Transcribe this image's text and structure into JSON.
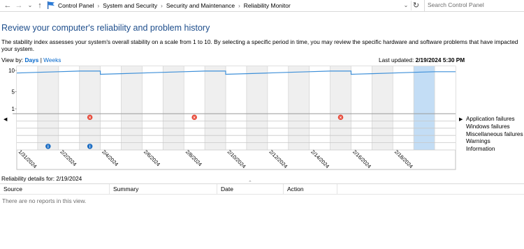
{
  "nav": {
    "breadcrumbs": [
      "Control Panel",
      "System and Security",
      "Security and Maintenance",
      "Reliability Monitor"
    ],
    "search_placeholder": "Search Control Panel"
  },
  "header": {
    "title": "Review your computer's reliability and problem history",
    "description": "The stability index assesses your system's overall stability on a scale from 1 to 10. By selecting a specific period in time, you may review the specific hardware and software problems that have impacted your system."
  },
  "view": {
    "label": "View by:",
    "days": "Days",
    "separator": "|",
    "weeks": "Weeks",
    "selected": "Days",
    "last_updated_label": "Last updated:",
    "last_updated_value": "2/19/2024 5:30 PM"
  },
  "chart_data": {
    "type": "line",
    "y_ticks": [
      "10",
      "5",
      "1"
    ],
    "ylim": [
      1,
      10
    ],
    "columns": [
      "1/31",
      "2/1",
      "2/2",
      "2/3",
      "2/4",
      "2/5",
      "2/6",
      "2/7",
      "2/8",
      "2/9",
      "2/10",
      "2/11",
      "2/12",
      "2/13",
      "2/14",
      "2/15",
      "2/16",
      "2/17",
      "2/18",
      "2/19",
      "2/20"
    ],
    "date_labels": [
      "1/31/2024",
      "2/2/2024",
      "2/4/2024",
      "2/6/2024",
      "2/8/2024",
      "2/10/2024",
      "2/12/2024",
      "2/14/2024",
      "2/16/2024",
      "2/18/2024"
    ],
    "stability_index": [
      9.4,
      9.55,
      9.7,
      9.85,
      9.1,
      9.25,
      9.4,
      9.55,
      9.7,
      9.85,
      9.1,
      9.25,
      9.4,
      9.55,
      9.7,
      9.85,
      9.1,
      9.25,
      9.4,
      9.55,
      9.7
    ],
    "event_rows": [
      "Application failures",
      "Windows failures",
      "Miscellaneous failures",
      "Warnings",
      "Information"
    ],
    "events": [
      {
        "row": "Application failures",
        "column": "2/3",
        "icon": "error"
      },
      {
        "row": "Application failures",
        "column": "2/8",
        "icon": "error"
      },
      {
        "row": "Application failures",
        "column": "2/15",
        "icon": "error"
      },
      {
        "row": "Information",
        "column": "2/1",
        "icon": "info"
      },
      {
        "row": "Information",
        "column": "2/3",
        "icon": "info"
      }
    ],
    "selected_column": "2/19",
    "colors": {
      "line": "#3d8fd8",
      "selected": "#c3ddf5",
      "shade": "#efefef",
      "error": "#e74c3c",
      "info": "#1f6fc4"
    }
  },
  "details": {
    "label": "Reliability details for: 2/19/2024",
    "columns": [
      "Source",
      "Summary",
      "Date",
      "Action"
    ],
    "empty_text": "There are no reports in this view."
  }
}
